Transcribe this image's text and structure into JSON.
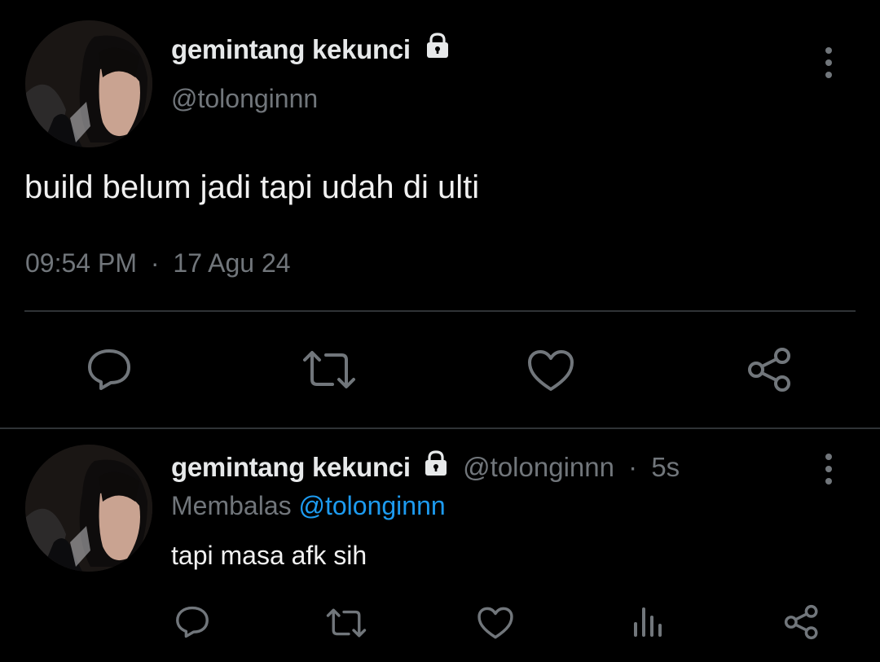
{
  "main_tweet": {
    "display_name": "gemintang kekunci",
    "handle": "@tolonginnn",
    "locked": true,
    "text": "build belum jadi tapi udah di ulti",
    "time": "09:54 PM",
    "separator": "·",
    "date": "17 Agu 24",
    "actions": [
      "reply-icon",
      "retweet-icon",
      "like-icon",
      "share-icon"
    ]
  },
  "reply_tweet": {
    "display_name": "gemintang kekunci",
    "handle": "@tolonginnn",
    "separator": "·",
    "age": "5s",
    "replying_label": "Membalas",
    "replying_to": "@tolonginnn",
    "text": "tapi masa afk sih",
    "actions": [
      "reply-icon",
      "retweet-icon",
      "like-icon",
      "views-icon",
      "share-icon"
    ]
  },
  "colors": {
    "background": "#000000",
    "text_primary": "#e7e9ea",
    "text_secondary": "#71767b",
    "link": "#1d9bf0",
    "divider": "#2f3336"
  }
}
